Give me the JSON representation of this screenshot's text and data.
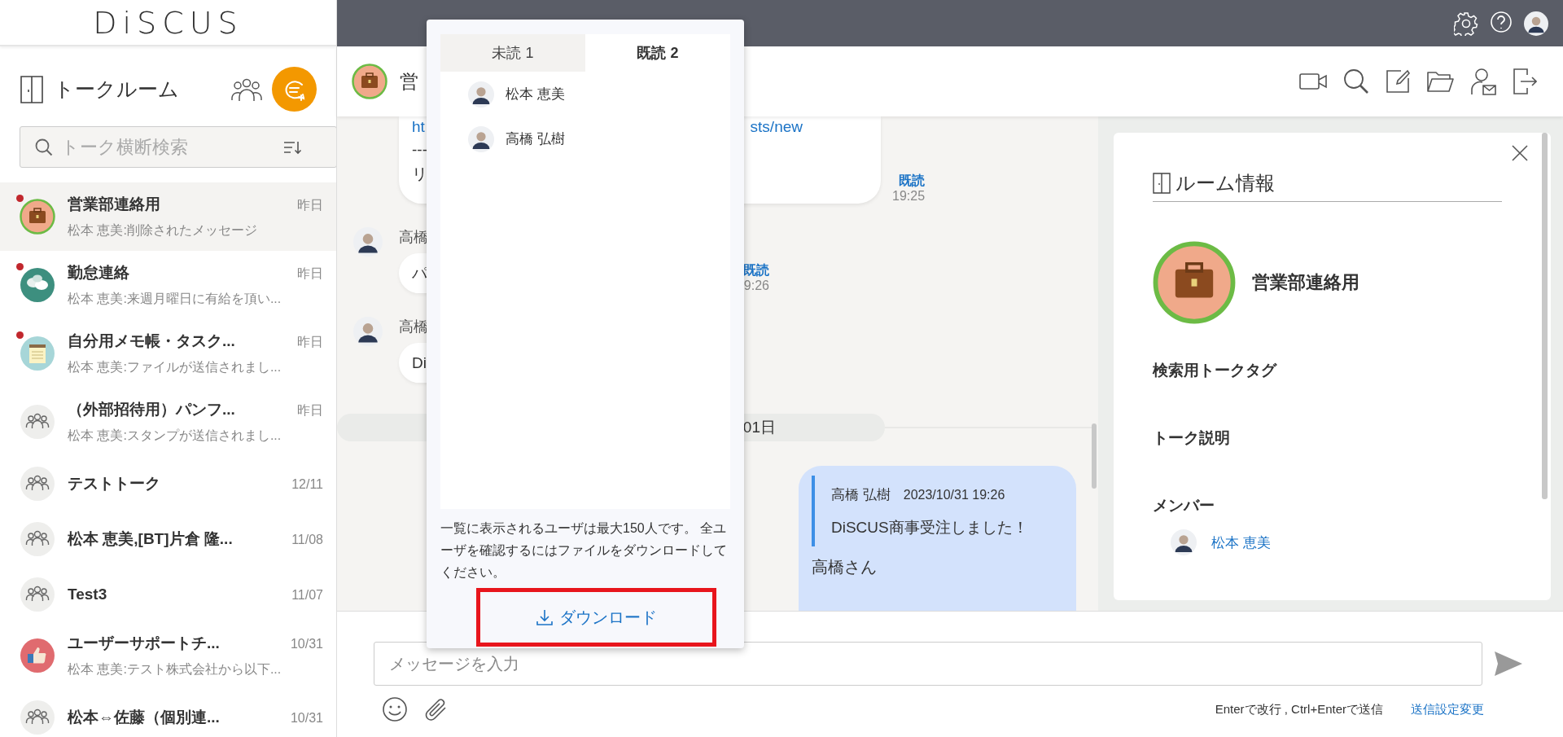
{
  "logo": "DiSCUS",
  "sidebar": {
    "title": "トークルーム",
    "search": {
      "placeholder": "トーク横断検索"
    },
    "rooms": [
      {
        "name": "営業部連絡用",
        "date": "昨日",
        "preview": "松本 恵美:削除されたメッセージ",
        "kind": "briefcase",
        "unread": true,
        "selected": true
      },
      {
        "name": "勤怠連絡",
        "date": "昨日",
        "preview": "松本 恵美:来週月曜日に有給を頂い...",
        "kind": "speech",
        "unread": true,
        "selected": false
      },
      {
        "name": "自分用メモ帳・タスク...",
        "date": "昨日",
        "preview": "松本 恵美:ファイルが送信されまし...",
        "kind": "notepad",
        "unread": true,
        "selected": false
      },
      {
        "name": "（外部招待用）パンフ...",
        "date": "昨日",
        "preview": "松本 恵美:スタンプが送信されまし...",
        "kind": "group",
        "unread": false,
        "selected": false
      },
      {
        "name": "テストトーク",
        "date": "12/11",
        "kind": "group",
        "unread": false,
        "selected": false
      },
      {
        "name": "松本 恵美,[BT]片倉 隆...",
        "date": "11/08",
        "kind": "group",
        "unread": false,
        "selected": false
      },
      {
        "name": "Test3",
        "date": "11/07",
        "kind": "group",
        "unread": false,
        "selected": false
      },
      {
        "name": "ユーザーサポートチ...",
        "date": "10/31",
        "preview": "松本 恵美:テスト株式会社から以下...",
        "kind": "thumbs",
        "unread": false,
        "selected": false
      },
      {
        "name": "松本⇔佐藤（個別連...",
        "date": "10/31",
        "kind": "group",
        "unread": false,
        "selected": false
      }
    ]
  },
  "chat": {
    "room_name": "営",
    "messages": [
      {
        "kind": "incoming",
        "lines": [
          "ht",
          "---",
          "リ"
        ],
        "link_tail": "sts/new",
        "read": "既読",
        "time": "19:25"
      },
      {
        "kind": "incoming",
        "sender": "高橋",
        "lines": [
          "パ"
        ],
        "read": "既読",
        "time": "9:26"
      },
      {
        "kind": "incoming",
        "sender": "高橋",
        "lines": [
          "Di"
        ]
      },
      {
        "kind": "date",
        "label": "01日"
      },
      {
        "kind": "outgoing",
        "quote": {
          "sender": "高橋 弘樹",
          "time": "2023/10/31 19:26",
          "text": "DiSCUS商事受注しました！"
        },
        "lines": [
          "高橋さん"
        ]
      }
    ]
  },
  "read_popup": {
    "tabs": [
      {
        "label": "未読 1",
        "selected": false
      },
      {
        "label": "既読 2",
        "selected": true
      }
    ],
    "readers": [
      "松本 恵美",
      "高橋 弘樹"
    ],
    "note": "一覧に表示されるユーザは最大150人です。 全ユーザを確認するにはファイルをダウンロードしてください。",
    "download": {
      "label": "ダウンロード",
      "highlighted": true
    }
  },
  "room_info": {
    "title": "ルーム情報",
    "room_name": "営業部連絡用",
    "sections": [
      "検索用トークタグ",
      "トーク説明",
      "メンバー"
    ],
    "members": [
      "松本 恵美"
    ]
  },
  "composer": {
    "placeholder": "メッセージを入力",
    "hint": "Enterで改行 , Ctrl+Enterで送信",
    "settings_link": "送信設定変更"
  }
}
